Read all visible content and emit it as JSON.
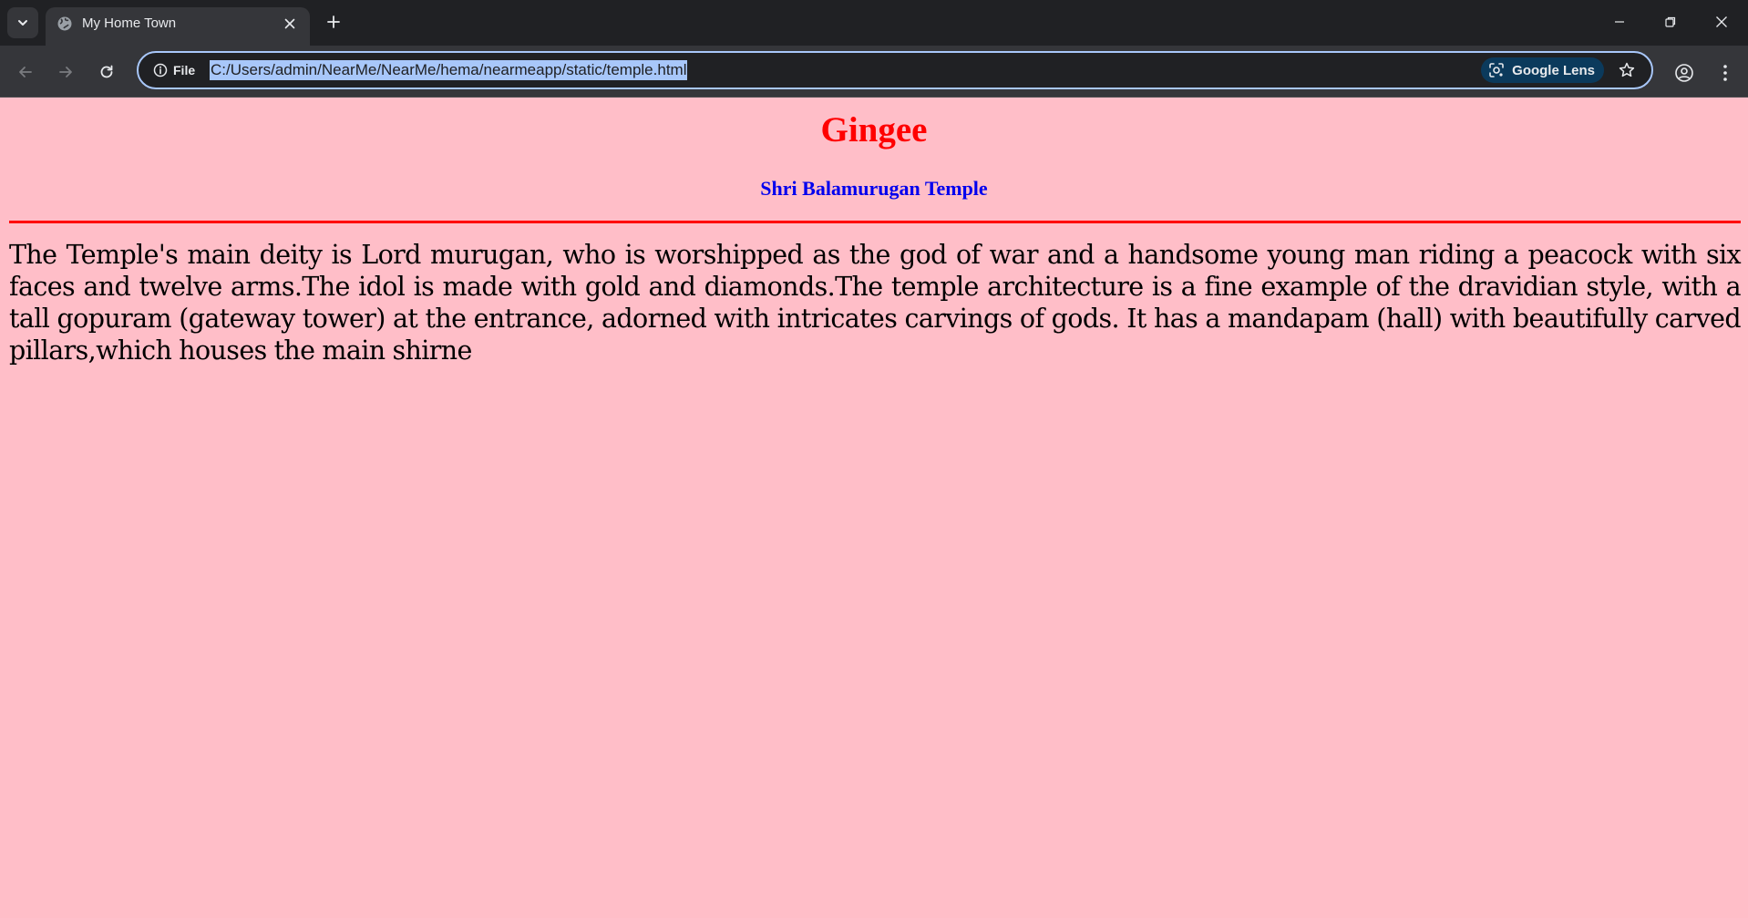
{
  "browser": {
    "tab": {
      "title": "My Home Town",
      "favicon": "globe-icon"
    },
    "address_bar": {
      "site_info_label": "File",
      "url": "C:/Users/admin/NearMe/NearMe/hema/nearmeapp/static/temple.html",
      "lens_label": "Google Lens"
    },
    "icons": {
      "tab_search": "chevron-down-icon",
      "tab_close": "close-icon",
      "new_tab": "plus-icon",
      "back": "arrow-left-icon",
      "forward": "arrow-right-icon",
      "reload": "reload-icon",
      "site_info": "info-icon",
      "lens": "camera-lens-icon",
      "bookmark": "star-icon",
      "profile": "profile-icon",
      "menu": "kebab-menu-icon",
      "minimize": "minimize-icon",
      "maximize": "restore-icon",
      "close_window": "close-icon"
    }
  },
  "page": {
    "title": "Gingee",
    "subtitle": "Shri Balamurugan Temple",
    "description": "The Temple's main deity is Lord murugan, who is worshipped as the god of war and a handsome young man riding a peacock with six faces and twelve arms.The idol is made with gold and diamonds.The temple architecture is a fine example of the dravidian style, with a tall gopuram (gateway tower) at the entrance, adorned with intricates carvings of gods. It has a mandapam (hall) with beautifully carved pillars,which houses the main shirne"
  },
  "colors": {
    "page_background": "#ffbec8",
    "title": "#ff0000",
    "subtitle": "#0000ee",
    "rule": "#ff0000",
    "chrome_dark": "#202124",
    "chrome_toolbar": "#35363a",
    "url_highlight": "#a8c7fa"
  }
}
